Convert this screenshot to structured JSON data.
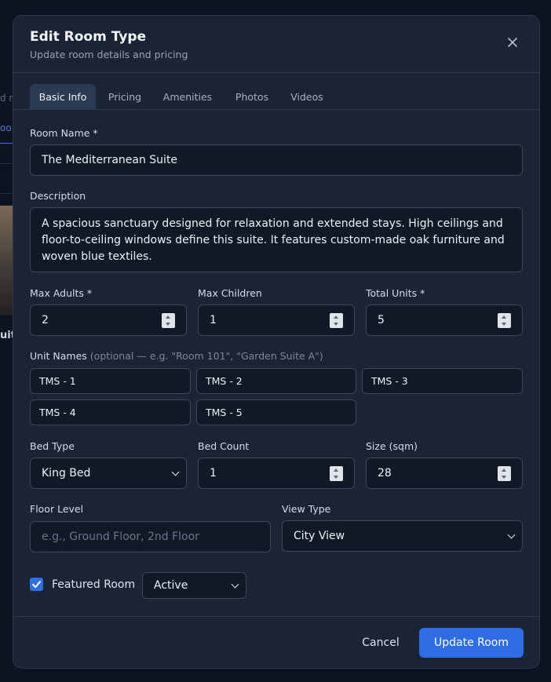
{
  "modal": {
    "title": "Edit Room Type",
    "subtitle": "Update room details and pricing"
  },
  "tabs": [
    {
      "label": "Basic Info",
      "active": true
    },
    {
      "label": "Pricing"
    },
    {
      "label": "Amenities"
    },
    {
      "label": "Photos"
    },
    {
      "label": "Videos"
    }
  ],
  "form": {
    "room_name_label": "Room Name *",
    "room_name_value": "The Mediterranean Suite",
    "description_label": "Description",
    "description_value": "A spacious sanctuary designed for relaxation and extended stays. High ceilings and floor-to-ceiling windows define this suite. It features custom-made oak furniture and woven blue textiles.",
    "max_adults_label": "Max Adults *",
    "max_adults_value": "2",
    "max_children_label": "Max Children",
    "max_children_value": "1",
    "total_units_label": "Total Units *",
    "total_units_value": "5",
    "unit_names_label": "Unit Names",
    "unit_names_hint": "(optional — e.g. \"Room 101\", \"Garden Suite A\")",
    "unit_names": [
      "TMS - 1",
      "TMS - 2",
      "TMS - 3",
      "TMS - 4",
      "TMS - 5"
    ],
    "bed_type_label": "Bed Type",
    "bed_type_value": "King Bed",
    "bed_count_label": "Bed Count",
    "bed_count_value": "1",
    "size_label": "Size (sqm)",
    "size_value": "28",
    "floor_level_label": "Floor Level",
    "floor_level_placeholder": "e.g., Ground Floor, 2nd Floor",
    "view_type_label": "View Type",
    "view_type_value": "City View",
    "featured_label": "Featured Room",
    "featured_checked": true,
    "status_value": "Active"
  },
  "footer": {
    "cancel_label": "Cancel",
    "submit_label": "Update Room"
  },
  "background": {
    "fragment_1": "d m",
    "fragment_2": "oo",
    "fragment_3": "uite"
  },
  "colors": {
    "accent": "#2e6de6",
    "modal_bg": "#1b2434",
    "input_bg": "#111826"
  }
}
